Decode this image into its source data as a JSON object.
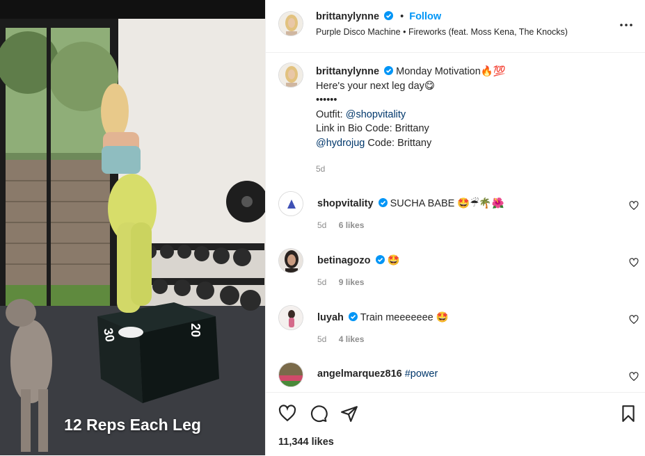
{
  "media": {
    "overlay_text": "12 Reps Each Leg"
  },
  "header": {
    "username": "brittanylynne",
    "follow_label": "Follow",
    "separator": "•",
    "audio_artist": "Purple Disco Machine",
    "audio_track": "Fireworks (feat. Moss Kena, The Knocks)"
  },
  "caption": {
    "username": "brittanylynne",
    "line1": "Monday Motivation🔥💯",
    "line2": "Here's your next leg day😋",
    "line3": "••••••",
    "line4_prefix": "Outfit: ",
    "line4_mention": "@shopvitality",
    "line5": "Link in Bio Code: Brittany",
    "line6_mention": "@hydrojug",
    "line6_suffix": " Code: Brittany",
    "time": "5d"
  },
  "comments": [
    {
      "username": "shopvitality",
      "text": "SUCHA BABE 🤩☔🌴🌺",
      "time": "5d",
      "likes": "6 likes",
      "verified": true
    },
    {
      "username": "betinagozo",
      "text": "🤩",
      "time": "5d",
      "likes": "9 likes",
      "verified": true
    },
    {
      "username": "luyah",
      "text": "Train meeeeeee 🤩",
      "time": "5d",
      "likes": "4 likes",
      "verified": true
    },
    {
      "username": "angelmarquez816",
      "text": "#power",
      "verified": false
    }
  ],
  "footer": {
    "likes": "11,344 likes"
  },
  "colors": {
    "accent": "#0095f6",
    "mention": "#00376b",
    "muted": "#8e8e8e",
    "border": "#efefef"
  },
  "icons": [
    "verified-badge-icon",
    "more-icon",
    "heart-icon",
    "comment-icon",
    "share-icon",
    "bookmark-icon"
  ]
}
